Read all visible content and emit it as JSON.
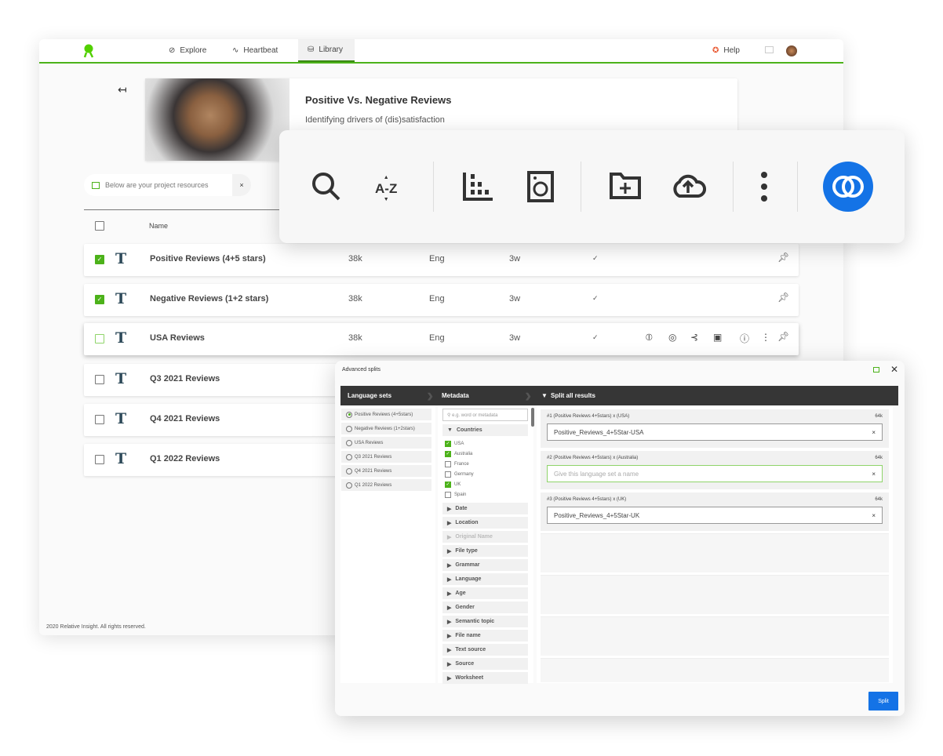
{
  "nav": {
    "items": [
      {
        "label": "Explore",
        "icon": "compass-icon"
      },
      {
        "label": "Heartbeat",
        "icon": "pulse-icon"
      },
      {
        "label": "Library",
        "icon": "database-icon",
        "active": true
      }
    ],
    "help": "Help"
  },
  "project": {
    "title": "Positive Vs. Negative Reviews",
    "subtitle": "Identifying drivers of (dis)satisfaction"
  },
  "toast": {
    "text": "Below are your project resources",
    "close": "×"
  },
  "table": {
    "header": {
      "name": "Name"
    },
    "rows": [
      {
        "name": "Positive Reviews (4+5 stars)",
        "size": "38k",
        "lang": "Eng",
        "age": "3w",
        "status": "✓",
        "checked": true
      },
      {
        "name": "Negative Reviews (1+2 stars)",
        "size": "38k",
        "lang": "Eng",
        "age": "3w",
        "status": "✓",
        "checked": true
      },
      {
        "name": "USA Reviews",
        "size": "38k",
        "lang": "Eng",
        "age": "3w",
        "status": "✓",
        "checked": false,
        "hovered": true
      },
      {
        "name": "Q3 2021 Reviews",
        "checked": false
      },
      {
        "name": "Q4 2021 Reviews",
        "checked": false
      },
      {
        "name": "Q1 2022 Reviews",
        "checked": false
      }
    ]
  },
  "footer": "2020 Relative Insight. All rights reserved.",
  "toolbar": {
    "icons": [
      "search-icon",
      "sort-az-icon",
      "chart-icon",
      "washing-machine-icon",
      "folder-add-icon",
      "cloud-upload-icon",
      "more-vertical-icon",
      "split-icon"
    ],
    "sort_label": "A-Z",
    "accent": "#1473e6"
  },
  "modal": {
    "title": "Advanced splits",
    "steps": [
      "Language sets",
      "Metadata",
      "Split all results"
    ],
    "language_sets": [
      {
        "label": "Positive Reviews (4+5stars)",
        "selected": true
      },
      {
        "label": "Negative Reviews (1+2stars)"
      },
      {
        "label": "USA Reviews"
      },
      {
        "label": "Q3 2021 Reviews"
      },
      {
        "label": "Q4 2021 Reviews"
      },
      {
        "label": "Q1 2022 Reviews"
      }
    ],
    "search_placeholder": "e.g. word or metadata",
    "countries_label": "Countries",
    "countries": [
      {
        "label": "USA",
        "checked": true
      },
      {
        "label": "Australia",
        "checked": true
      },
      {
        "label": "France",
        "checked": false
      },
      {
        "label": "Germany",
        "checked": false
      },
      {
        "label": "UK",
        "checked": true
      },
      {
        "label": "Spain",
        "checked": false
      }
    ],
    "sections": [
      {
        "label": "Date"
      },
      {
        "label": "Location"
      },
      {
        "label": "Original Name",
        "disabled": true
      },
      {
        "label": "File type"
      },
      {
        "label": "Grammar"
      },
      {
        "label": "Language"
      },
      {
        "label": "Age"
      },
      {
        "label": "Gender"
      },
      {
        "label": "Semantic topic"
      },
      {
        "label": "File name"
      },
      {
        "label": "Text source"
      },
      {
        "label": "Source"
      },
      {
        "label": "Worksheet"
      }
    ],
    "results": [
      {
        "label": "#1 (Positive Reviews 4+5stars) x (USA)",
        "count": "64k",
        "value": "Positive_Reviews_4+5Star-USA"
      },
      {
        "label": "#2 (Positive Reviews 4+5stars) x (Australia)",
        "count": "64k",
        "value": "",
        "placeholder": "Give this language set a name"
      },
      {
        "label": "#3 (Positive Reviews 4+5stars) x (UK)",
        "count": "64k",
        "value": "Positive_Reviews_4+5Star-UK"
      }
    ],
    "split_button": "Split"
  }
}
